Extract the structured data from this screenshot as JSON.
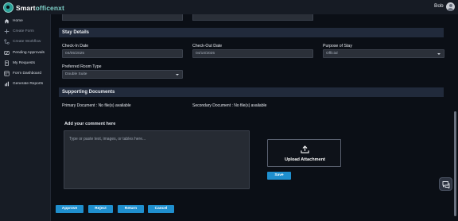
{
  "app": {
    "brand_prefix": "Smart",
    "brand_suffix": "officenxt",
    "user_name": "Bob"
  },
  "sidebar": {
    "items": [
      {
        "label": "Home",
        "icon": "home-icon",
        "muted": false
      },
      {
        "label": "Create Form",
        "icon": "plus-icon",
        "muted": true
      },
      {
        "label": "Create Workflow",
        "icon": "workflow-icon",
        "muted": true
      },
      {
        "label": "Pending Approvals",
        "icon": "pending-icon",
        "muted": false
      },
      {
        "label": "My Requests",
        "icon": "requests-icon",
        "muted": false
      },
      {
        "label": "Form Dashboard",
        "icon": "dashboard-icon",
        "muted": false
      },
      {
        "label": "Generate Reports",
        "icon": "reports-icon",
        "muted": false
      }
    ]
  },
  "stay_details": {
    "title": "Stay Details",
    "check_in": {
      "label": "Check-In Date",
      "value": "04/05/2025"
    },
    "check_out": {
      "label": "Check-Out Date",
      "value": "04/10/2025"
    },
    "purpose": {
      "label": "Purpose of Stay",
      "value": "Official"
    },
    "room_type": {
      "label": "Preferred Room Type",
      "value": "Double Suite"
    }
  },
  "supporting_documents": {
    "title": "Supporting Documents",
    "primary": "Primary Document : No file(s) available",
    "secondary": "Secondary Document : No file(s) available"
  },
  "comment": {
    "label": "Add your comment here",
    "placeholder": "Type or paste text, images, or tables here..."
  },
  "upload": {
    "label": "Upload Attachment",
    "icon": "upload-icon"
  },
  "actions": {
    "save": "Save",
    "approve": "Approve",
    "reject": "Reject",
    "return": "Return",
    "cancel": "Cancel"
  },
  "colors": {
    "accent": "#1f8fce",
    "section_bar": "#212a3b",
    "background": "#0b0f16"
  }
}
